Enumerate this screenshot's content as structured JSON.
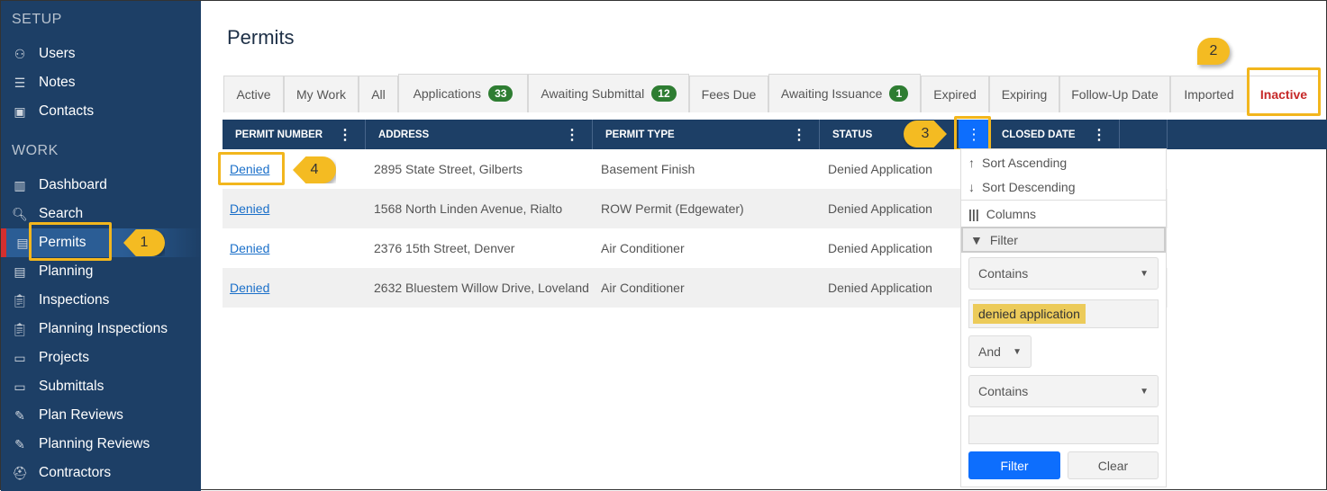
{
  "sidebar": {
    "setup_label": "SETUP",
    "work_label": "WORK",
    "setup_items": [
      {
        "label": "Users",
        "icon": "user-icon"
      },
      {
        "label": "Notes",
        "icon": "notes-icon"
      },
      {
        "label": "Contacts",
        "icon": "contacts-icon"
      }
    ],
    "work_items": [
      {
        "label": "Dashboard",
        "icon": "dashboard-icon"
      },
      {
        "label": "Search",
        "icon": "search-icon"
      },
      {
        "label": "Permits",
        "icon": "document-icon",
        "active": true
      },
      {
        "label": "Planning",
        "icon": "document-icon"
      },
      {
        "label": "Inspections",
        "icon": "clipboard-icon"
      },
      {
        "label": "Planning Inspections",
        "icon": "clipboard-icon"
      },
      {
        "label": "Projects",
        "icon": "folder-icon"
      },
      {
        "label": "Submittals",
        "icon": "folder-icon"
      },
      {
        "label": "Plan Reviews",
        "icon": "review-icon"
      },
      {
        "label": "Planning Reviews",
        "icon": "review-icon"
      },
      {
        "label": "Contractors",
        "icon": "hardhat-icon"
      }
    ]
  },
  "page": {
    "title": "Permits"
  },
  "tabs": [
    {
      "label": "Active"
    },
    {
      "label": "My Work"
    },
    {
      "label": "All"
    },
    {
      "label": "Applications",
      "badge": "33"
    },
    {
      "label": "Awaiting Submittal",
      "badge": "12"
    },
    {
      "label": "Fees Due"
    },
    {
      "label": "Awaiting Issuance",
      "badge": "1"
    },
    {
      "label": "Expired"
    },
    {
      "label": "Expiring"
    },
    {
      "label": "Follow-Up Date"
    },
    {
      "label": "Imported"
    },
    {
      "label": "Inactive",
      "active": true
    }
  ],
  "table": {
    "columns": [
      "PERMIT NUMBER",
      "ADDRESS",
      "PERMIT TYPE",
      "STATUS",
      "CLOSED DATE"
    ],
    "rows": [
      {
        "number": "Denied",
        "address": "2895 State Street, Gilberts",
        "type": "Basement Finish",
        "status": "Denied Application"
      },
      {
        "number": "Denied",
        "address": "1568 North Linden Avenue, Rialto",
        "type": "ROW Permit (Edgewater)",
        "status": "Denied Application"
      },
      {
        "number": "Denied",
        "address": "2376 15th Street, Denver",
        "type": "Air Conditioner",
        "status": "Denied Application"
      },
      {
        "number": "Denied",
        "address": "2632 Bluestem Willow Drive, Loveland",
        "type": "Air Conditioner",
        "status": "Denied Application"
      }
    ]
  },
  "column_menu": {
    "sort_asc": "Sort Ascending",
    "sort_desc": "Sort Descending",
    "columns": "Columns",
    "filter": "Filter",
    "operator1": "Contains",
    "value1": "denied application",
    "logic": "And",
    "operator2": "Contains",
    "value2": "",
    "filter_button": "Filter",
    "clear_button": "Clear"
  },
  "callouts": [
    "1",
    "2",
    "3",
    "4"
  ],
  "colors": {
    "sidebar": "#1d3f66",
    "accent": "#0d6efd",
    "active_tab": "#c62828",
    "callout": "#f4bb22"
  }
}
